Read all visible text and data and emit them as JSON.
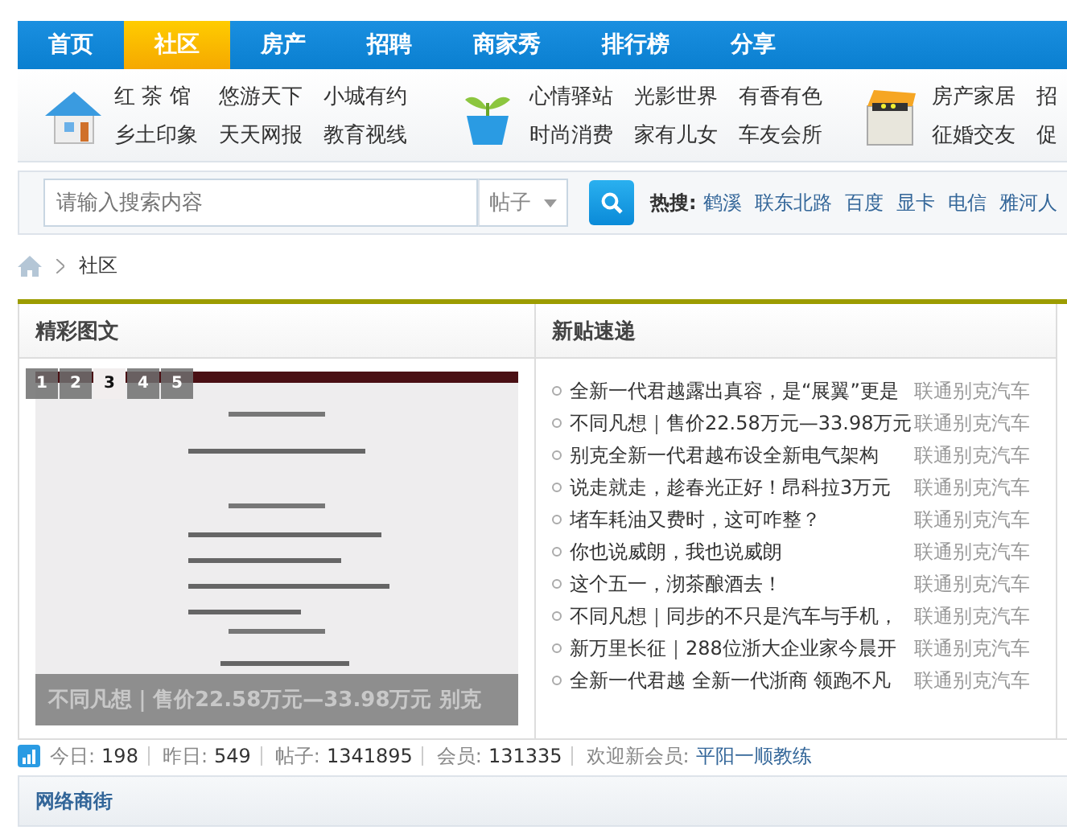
{
  "nav": {
    "tabs": [
      {
        "label": "首页",
        "selected": false
      },
      {
        "label": "社区",
        "selected": true
      },
      {
        "label": "房产",
        "selected": false
      },
      {
        "label": "招聘",
        "selected": false
      },
      {
        "label": "商家秀",
        "selected": false
      },
      {
        "label": "排行榜",
        "selected": false
      },
      {
        "label": "分享",
        "selected": false
      }
    ]
  },
  "quick_links": [
    {
      "kind": "house",
      "links": [
        "红 茶 馆",
        "悠游天下",
        "小城有约",
        "乡土印象",
        "天天网报",
        "教育视线"
      ]
    },
    {
      "kind": "plant",
      "links": [
        "心情驿站",
        "光影世界",
        "有香有色",
        "时尚消费",
        "家有儿女",
        "车友会所"
      ]
    },
    {
      "kind": "box",
      "links": [
        "房产家居",
        "招",
        "征婚交友",
        "促"
      ]
    }
  ],
  "search": {
    "placeholder": "请输入搜索内容",
    "scope": "帖子",
    "hot_label": "热搜:",
    "hot_terms": [
      "鹤溪",
      "联东北路",
      "百度",
      "显卡",
      "电信",
      "雅河人"
    ]
  },
  "breadcrumb": [
    "社区"
  ],
  "featured": {
    "title": "精彩图文",
    "slides": [
      {
        "label": "1",
        "selected": false
      },
      {
        "label": "2",
        "selected": false
      },
      {
        "label": "3",
        "selected": true
      },
      {
        "label": "4",
        "selected": false
      },
      {
        "label": "5",
        "selected": false
      }
    ],
    "caption": "不同凡想｜售价22.58万元—33.98万元 别克"
  },
  "news": {
    "title": "新贴速递",
    "posts": [
      {
        "title": "全新一代君越露出真容，是“展翼”更是",
        "author": "联通别克汽车"
      },
      {
        "title": "不同凡想｜售价22.58万元—33.98万元",
        "author": "联通别克汽车"
      },
      {
        "title": "别克全新一代君越布设全新电气架构",
        "author": "联通别克汽车"
      },
      {
        "title": "说走就走，趁春光正好！昂科拉3万元",
        "author": "联通别克汽车"
      },
      {
        "title": "堵车耗油又费时，这可咋整？",
        "author": "联通别克汽车"
      },
      {
        "title": "你也说威朗，我也说威朗",
        "author": "联通别克汽车"
      },
      {
        "title": "这个五一，沏茶酿酒去！",
        "author": "联通别克汽车"
      },
      {
        "title": "不同凡想｜同步的不只是汽车与手机，",
        "author": "联通别克汽车"
      },
      {
        "title": "新万里长征｜288位浙大企业家今晨开",
        "author": "联通别克汽车"
      },
      {
        "title": "全新一代君越 全新一代浙商 领跑不凡",
        "author": "联通别克汽车"
      }
    ]
  },
  "stats": {
    "items": [
      {
        "label": "今日:",
        "value": "198"
      },
      {
        "label": "昨日:",
        "value": "549"
      },
      {
        "label": "帖子:",
        "value": "1341895"
      },
      {
        "label": "会员:",
        "value": "131335"
      }
    ],
    "welcome_label": "欢迎新会员:",
    "new_member": "平阳一顺教练"
  },
  "section": {
    "title": "网络商街"
  }
}
